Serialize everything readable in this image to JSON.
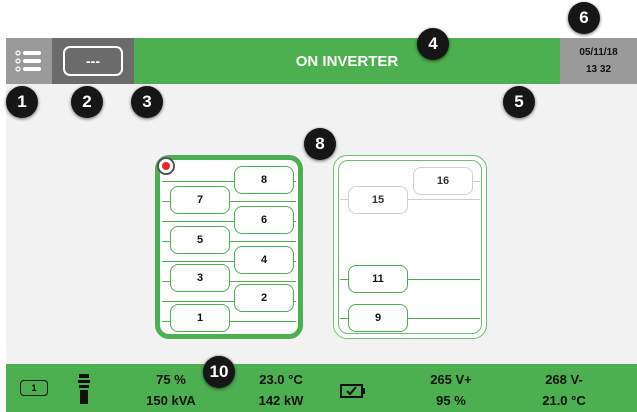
{
  "header": {
    "mode_label": "---",
    "status_text": "ON INVERTER",
    "date": "05/11/18",
    "time": "13 32"
  },
  "callouts": [
    "1",
    "2",
    "3",
    "4",
    "5",
    "6",
    "8",
    "10"
  ],
  "diagram": {
    "active_modules": [
      "8",
      "7",
      "6",
      "5",
      "4",
      "3",
      "2",
      "1"
    ],
    "idle_modules": [
      "16",
      "15",
      "11",
      "9"
    ]
  },
  "footer": {
    "chip_label": "1",
    "load_percent": "75 %",
    "apparent_power": "150 kVA",
    "temperature": "23.0 °C",
    "active_power": "142 kW",
    "voltage_pos": "265 V+",
    "charge_percent": "95 %",
    "voltage_neg": "268 V-",
    "battery_temp": "21.0 °C"
  },
  "colors": {
    "accent_green": "#4caf50",
    "header_gray": "#9a9a9a",
    "mode_gray": "#6b6b6b",
    "alarm_red": "#e8262b"
  },
  "icons": [
    "menu-icon",
    "alarm-indicator-icon",
    "battery-chip-icon",
    "fan-tower-icon",
    "battery-ok-icon"
  ]
}
